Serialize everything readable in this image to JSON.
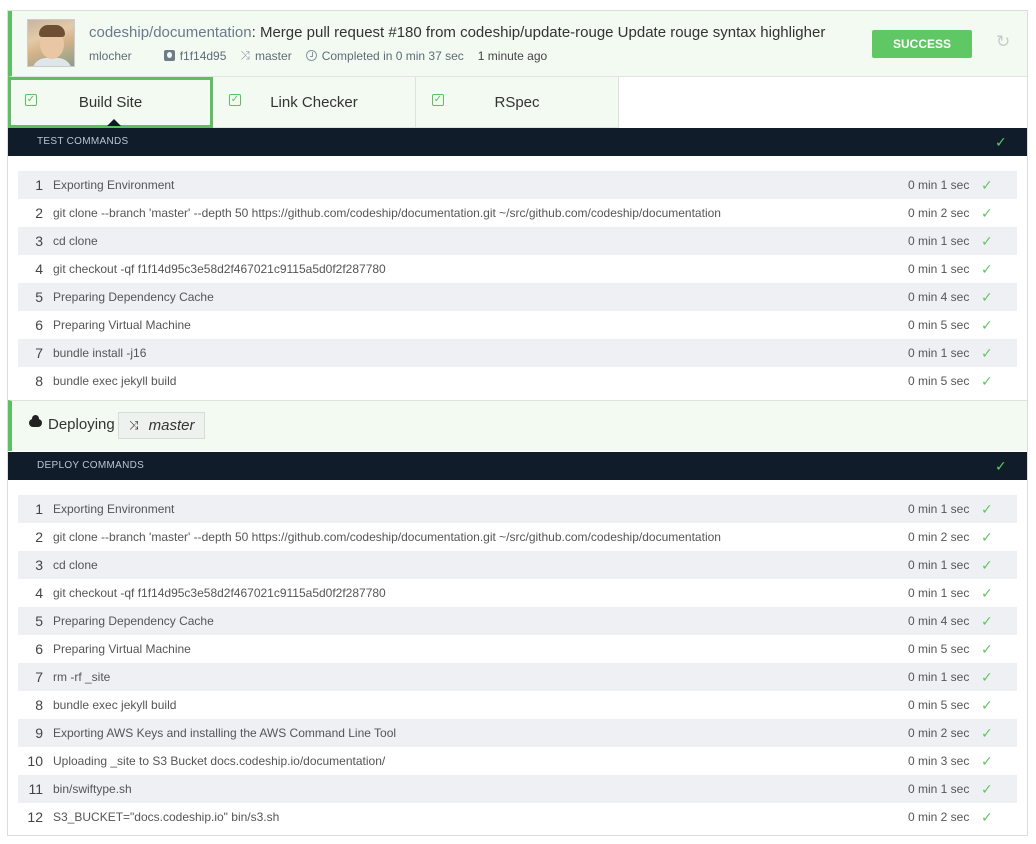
{
  "header": {
    "repo": "codeship/documentation",
    "separator": ":",
    "message": " Merge pull request #180 from codeship/update-rouge Update rouge syntax highligher",
    "author": "mlocher",
    "commit": "f1f14d95",
    "branch": "master",
    "completed": "Completed in 0 min 37 sec",
    "ago": "1 minute ago",
    "status": "SUCCESS",
    "status_color": "#5fc864"
  },
  "tabs": [
    {
      "label": "Build Site",
      "active": true
    },
    {
      "label": "Link Checker",
      "active": false
    },
    {
      "label": "RSpec",
      "active": false
    }
  ],
  "test_section": {
    "title": "TEST COMMANDS",
    "commands": [
      {
        "num": "1",
        "cmd": "Exporting Environment",
        "duration": "0 min 1 sec"
      },
      {
        "num": "2",
        "cmd": "git clone --branch 'master' --depth 50 https://github.com/codeship/documentation.git ~/src/github.com/codeship/documentation",
        "duration": "0 min 2 sec"
      },
      {
        "num": "3",
        "cmd": "cd clone",
        "duration": "0 min 1 sec"
      },
      {
        "num": "4",
        "cmd": "git checkout -qf f1f14d95c3e58d2f467021c9115a5d0f2f287780",
        "duration": "0 min 1 sec"
      },
      {
        "num": "5",
        "cmd": "Preparing Dependency Cache",
        "duration": "0 min 4 sec"
      },
      {
        "num": "6",
        "cmd": "Preparing Virtual Machine",
        "duration": "0 min 5 sec"
      },
      {
        "num": "7",
        "cmd": "bundle install -j16",
        "duration": "0 min 1 sec"
      },
      {
        "num": "8",
        "cmd": "bundle exec jekyll build",
        "duration": "0 min 5 sec"
      }
    ]
  },
  "deploy": {
    "label": "Deploying",
    "branch": "master"
  },
  "deploy_section": {
    "title": "DEPLOY COMMANDS",
    "commands": [
      {
        "num": "1",
        "cmd": "Exporting Environment",
        "duration": "0 min 1 sec"
      },
      {
        "num": "2",
        "cmd": "git clone --branch 'master' --depth 50 https://github.com/codeship/documentation.git ~/src/github.com/codeship/documentation",
        "duration": "0 min 2 sec"
      },
      {
        "num": "3",
        "cmd": "cd clone",
        "duration": "0 min 1 sec"
      },
      {
        "num": "4",
        "cmd": "git checkout -qf f1f14d95c3e58d2f467021c9115a5d0f2f287780",
        "duration": "0 min 1 sec"
      },
      {
        "num": "5",
        "cmd": "Preparing Dependency Cache",
        "duration": "0 min 4 sec"
      },
      {
        "num": "6",
        "cmd": "Preparing Virtual Machine",
        "duration": "0 min 5 sec"
      },
      {
        "num": "7",
        "cmd": "rm -rf _site",
        "duration": "0 min 1 sec"
      },
      {
        "num": "8",
        "cmd": "bundle exec jekyll build",
        "duration": "0 min 5 sec"
      },
      {
        "num": "9",
        "cmd": "Exporting AWS Keys and installing the AWS Command Line Tool",
        "duration": "0 min 2 sec"
      },
      {
        "num": "10",
        "cmd": "Uploading _site to S3 Bucket docs.codeship.io/documentation/",
        "duration": "0 min 3 sec"
      },
      {
        "num": "11",
        "cmd": "bin/swiftype.sh",
        "duration": "0 min 1 sec"
      },
      {
        "num": "12",
        "cmd": "S3_BUCKET=\"docs.codeship.io\" bin/s3.sh",
        "duration": "0 min 2 sec"
      }
    ]
  }
}
